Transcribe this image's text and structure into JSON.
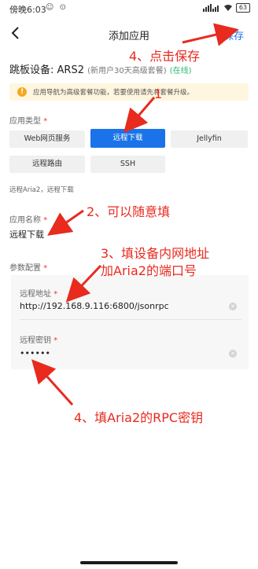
{
  "status_bar": {
    "time": "傍晚6:03",
    "left_icons": "☺ ⊙",
    "battery": "63"
  },
  "header": {
    "title": "添加应用",
    "save_label": "保存"
  },
  "device": {
    "label": "跳板设备: ARS2",
    "subtext": "(新用户30天高级套餐)",
    "status": "(在线)"
  },
  "notice": {
    "text": "应用导航为高级套餐功能，若要使用请先将套餐升级。"
  },
  "app_type": {
    "label": "应用类型",
    "options": [
      "Web网页服务",
      "远程下载",
      "Jellyfin",
      "远程路由",
      "SSH"
    ],
    "selected": "远程下载",
    "description": "远程Aria2，远程下载"
  },
  "app_name": {
    "label": "应用名称",
    "value": "远程下载"
  },
  "params": {
    "label": "参数配置",
    "remote_address_label": "远程地址",
    "remote_address_value": "http://192.168.9.116:6800/jsonrpc",
    "remote_key_label": "远程密钥",
    "remote_key_value": "••••••"
  },
  "annotations": {
    "a1": "1",
    "a2": "2、可以随意填",
    "a3_line1": "3、填设备内网地址",
    "a3_line2": "加Aria2的端口号",
    "a4_save": "4、点击保存",
    "a4_key": "4、填Aria2的RPC密钥"
  },
  "colors": {
    "accent": "#1a73e8",
    "annotation": "#e82a1f",
    "online": "#2bb673",
    "notice_bg": "#fff6df"
  }
}
